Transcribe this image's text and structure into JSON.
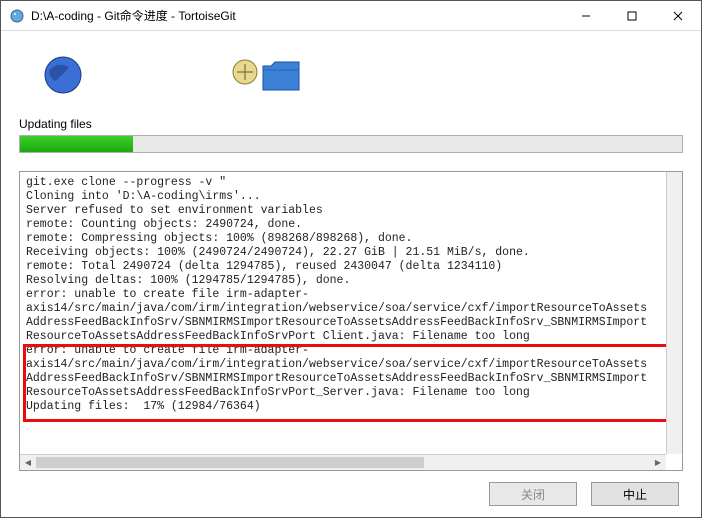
{
  "window": {
    "title": "D:\\A-coding - Git命令进度 - TortoiseGit"
  },
  "status": {
    "label": "Updating files"
  },
  "progress": {
    "percent": 17
  },
  "log": {
    "lines": "git.exe clone --progress -v \"\nCloning into 'D:\\A-coding\\irms'...\nServer refused to set environment variables\nremote: Counting objects: 2490724, done.\nremote: Compressing objects: 100% (898268/898268), done.\nReceiving objects: 100% (2490724/2490724), 22.27 GiB | 21.51 MiB/s, done.\nremote: Total 2490724 (delta 1294785), reused 2430047 (delta 1234110)\nResolving deltas: 100% (1294785/1294785), done.\nerror: unable to create file irm-adapter-\naxis14/src/main/java/com/irm/integration/webservice/soa/service/cxf/importResourceToAssets\nAddressFeedBackInfoSrv/SBNMIRMSImportResourceToAssetsAddressFeedBackInfoSrv_SBNMIRMSImport\nResourceToAssetsAddressFeedBackInfoSrvPort Client.java: Filename too long\nerror: unable to create file irm-adapter-\naxis14/src/main/java/com/irm/integration/webservice/soa/service/cxf/importResourceToAssets\nAddressFeedBackInfoSrv/SBNMIRMSImportResourceToAssetsAddressFeedBackInfoSrv_SBNMIRMSImport\nResourceToAssetsAddressFeedBackInfoSrvPort_Server.java: Filename too long\nUpdating files:  17% (12984/76364)"
  },
  "buttons": {
    "close": "关闭",
    "abort": "中止"
  }
}
